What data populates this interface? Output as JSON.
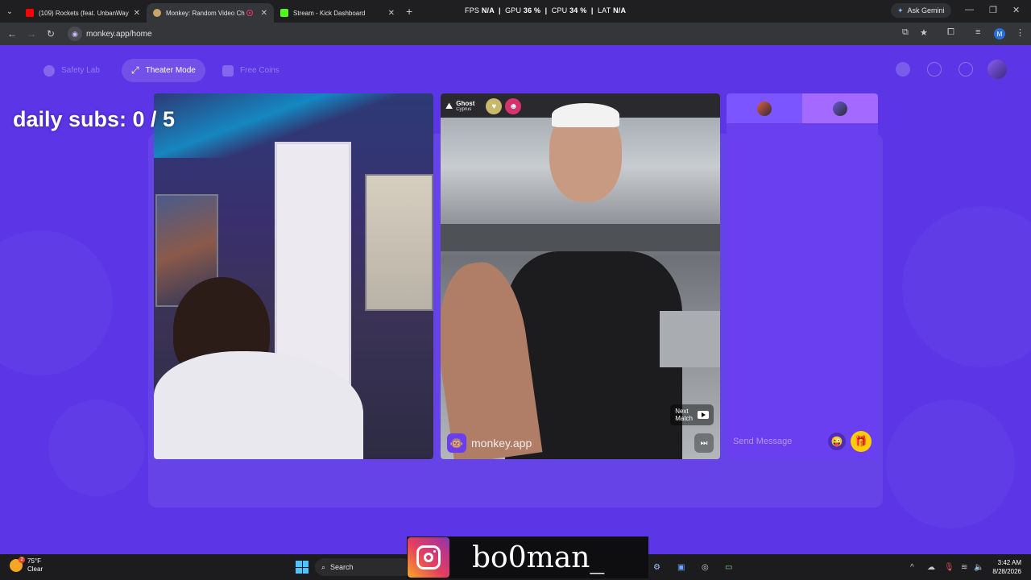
{
  "browser": {
    "tabs": [
      {
        "title": "(109) Rockets (feat. UnbanWay",
        "favicon_color": "#ff0000",
        "active": false
      },
      {
        "title": "Monkey: Random Video Ch",
        "favicon_color": "#c9a36a",
        "active": true
      },
      {
        "title": "Stream - Kick Dashboard",
        "favicon_color": "#53fc18",
        "active": false
      }
    ],
    "new_tab": "+",
    "url": "monkey.app/home",
    "ask_gemini": "Ask Gemini",
    "profile_initial": "M"
  },
  "overlay_stats": {
    "fps_label": "FPS",
    "fps_value": "N/A",
    "gpu_label": "GPU",
    "gpu_value": "36 %",
    "cpu_label": "CPU",
    "cpu_value": "34 %",
    "lat_label": "LAT",
    "lat_value": "N/A"
  },
  "app": {
    "nav": {
      "safety_lab": "Safety Lab",
      "theater_mode": "Theater Mode",
      "free_coins": "Free Coins"
    },
    "daily_subs": "daily subs: 0 / 5",
    "match": {
      "name": "Ghost",
      "country": "Cyprus",
      "next_match_line1": "Next",
      "next_match_line2": "Match"
    },
    "brand": "monkey.app",
    "chat": {
      "placeholder": "Send Message"
    },
    "colors": {
      "background": "#5b35e6",
      "gift": "#ffcc00"
    }
  },
  "stream_overlay": {
    "instagram_handle": "bo0man_"
  },
  "taskbar": {
    "weather_temp": "75°F",
    "weather_desc": "Clear",
    "weather_badge": "2",
    "search": "Search",
    "time": "3:42 AM",
    "date": "8/28/2026"
  }
}
